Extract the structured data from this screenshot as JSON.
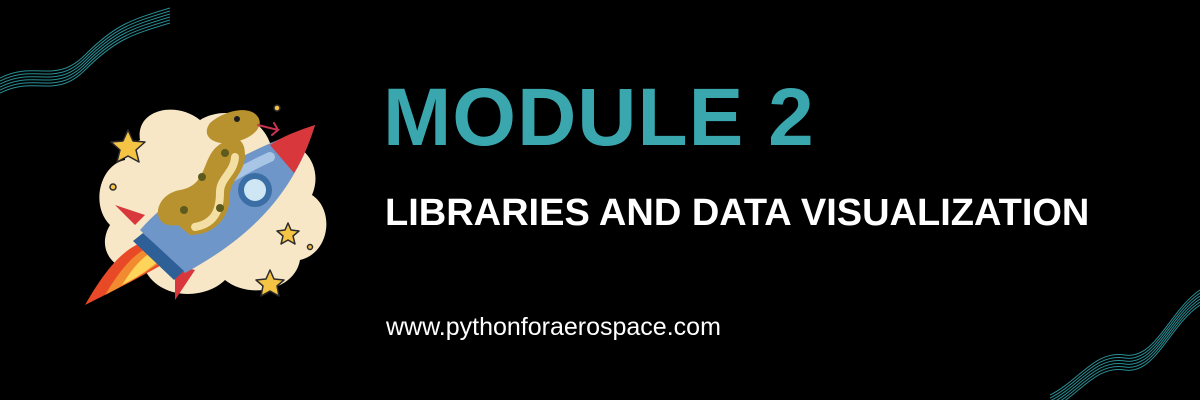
{
  "banner": {
    "title": "MODULE 2",
    "subtitle": "LIBRARIES AND DATA VISUALIZATION",
    "website": "www.pythonforaerospace.com"
  },
  "illustration": {
    "subject": "python-riding-rocket",
    "icons": [
      "snake-icon",
      "rocket-icon",
      "star-icon",
      "flame-icon"
    ]
  },
  "colors": {
    "background": "#000000",
    "accent": "#3aa6ad",
    "text": "#ffffff",
    "wave": "#2f9fa6",
    "cloud": "#f7e7c6",
    "rocket_body": "#6f96c9",
    "rocket_red": "#d8373b",
    "snake": "#b8922f",
    "star": "#f6c445"
  }
}
